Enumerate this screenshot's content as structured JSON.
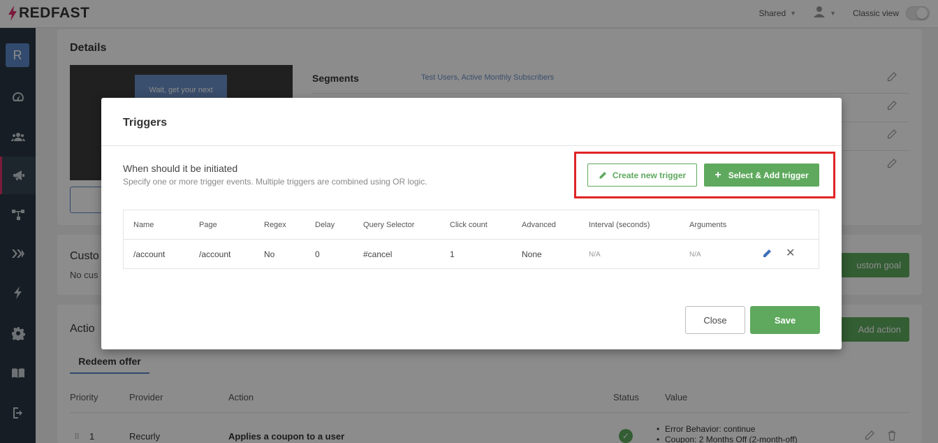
{
  "app": {
    "brand": "REDFAST"
  },
  "topbar": {
    "shared_label": "Shared",
    "classic_view_label": "Classic view"
  },
  "sidebar": {
    "avatar_letter": "R",
    "items": [
      {
        "icon": "dashboard-gauge-icon"
      },
      {
        "icon": "users-icon"
      },
      {
        "icon": "megaphone-icon",
        "active": true
      },
      {
        "icon": "flow-icon"
      },
      {
        "icon": "chevrons-icon"
      },
      {
        "icon": "bolt-icon"
      },
      {
        "icon": "gear-icon"
      },
      {
        "icon": "book-icon"
      },
      {
        "icon": "logout-icon"
      }
    ]
  },
  "details": {
    "title": "Details",
    "preview_text": "Wait, get your next",
    "segments_label": "Segments",
    "segments_value": "Test Users, Active Monthly Subscribers"
  },
  "goals": {
    "title_partial": "Custo",
    "empty_partial": "No cus",
    "button_partial": "ustom goal"
  },
  "actions": {
    "title_partial": "Actio",
    "add_button_partial": "Add action",
    "tab": "Redeem offer",
    "columns": [
      "Priority",
      "Provider",
      "Action",
      "Status",
      "Value"
    ],
    "row": {
      "priority": "1",
      "provider": "Recurly",
      "action": "Applies a coupon to a user",
      "value_items": [
        "Error Behavior: continue",
        "Coupon: 2 Months Off (2-month-off)"
      ]
    }
  },
  "modal": {
    "title": "Triggers",
    "when_title": "When should it be initiated",
    "when_subtitle": "Specify one or more trigger events. Multiple triggers are combined using OR logic.",
    "create_button": "Create new trigger",
    "select_button": "Select & Add trigger",
    "table": {
      "columns": [
        "Name",
        "Page",
        "Regex",
        "Delay",
        "Query Selector",
        "Click count",
        "Advanced",
        "Interval (seconds)",
        "Arguments"
      ],
      "rows": [
        {
          "name": "/account",
          "page": "/account",
          "regex": "No",
          "delay": "0",
          "query_selector": "#cancel",
          "click_count": "1",
          "advanced": "None",
          "interval": "N/A",
          "arguments": "N/A"
        }
      ]
    },
    "close_button": "Close",
    "save_button": "Save"
  },
  "colors": {
    "accent_green": "#5ea95d",
    "highlight_red": "#e02424",
    "sidebar_bg": "#293642",
    "link_blue": "#5c87c6"
  }
}
